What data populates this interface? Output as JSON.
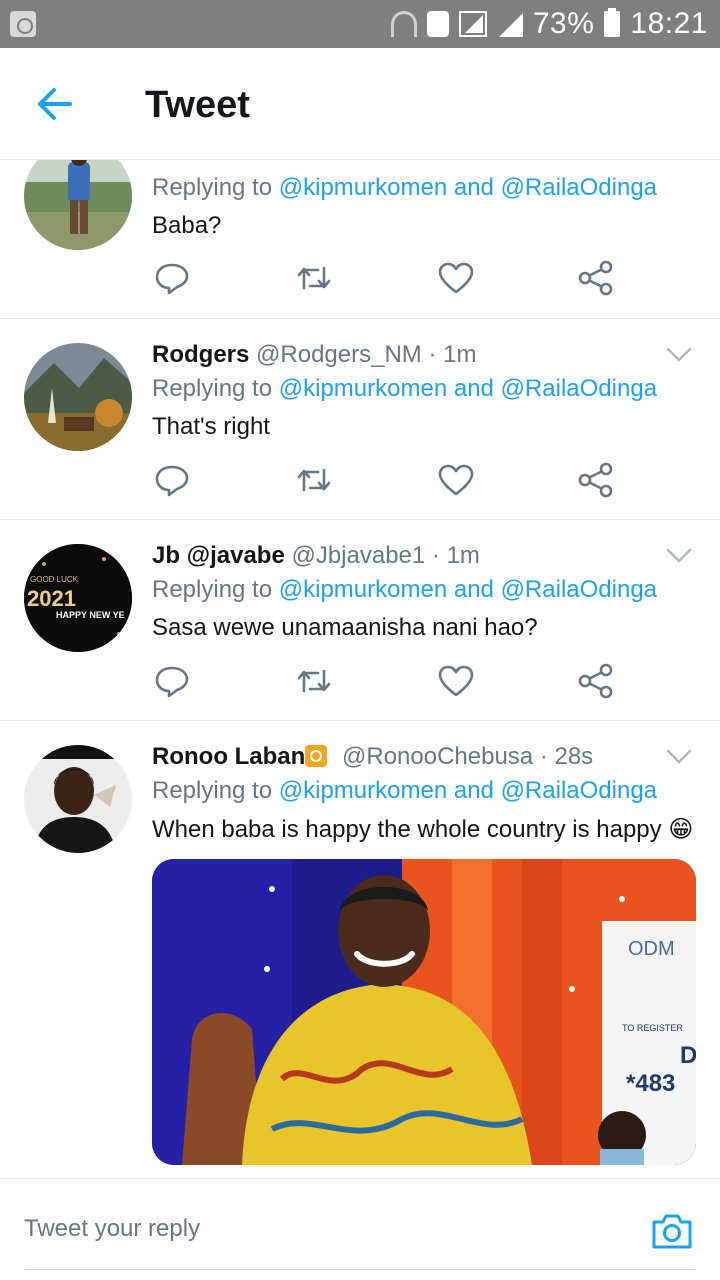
{
  "status_bar": {
    "battery_percent": "73%",
    "time": "18:21"
  },
  "header": {
    "title": "Tweet"
  },
  "replying_prefix": "Replying to",
  "mentions": {
    "first": "@kipmurkomen",
    "joiner": "and",
    "second": "@RailaOdinga"
  },
  "tweets": [
    {
      "name": "",
      "handle": "",
      "time": "",
      "text": "Baba?"
    },
    {
      "name": "Rodgers",
      "handle": "@Rodgers_NM",
      "time": "· 1m",
      "text": "That's right"
    },
    {
      "name": "Jb @javabe",
      "handle": "@Jbjavabe1",
      "time": "· 1m",
      "text": "Sasa wewe unamaanisha nani hao?",
      "avatar_text": {
        "year": "2021",
        "good_luck": "GOOD LUCK",
        "happy_new": "HAPPY NEW YE"
      }
    },
    {
      "name": "Ronoo Laban",
      "handle": "@RonooChebusa",
      "time": "· 28s",
      "text": "When baba is happy the whole country is happy 😁",
      "media_sign": {
        "line1": "ODM",
        "line2": "TO REGISTER",
        "line3": "D",
        "line4": "*483"
      }
    }
  ],
  "reply_bar": {
    "placeholder": "Tweet your reply"
  },
  "colors": {
    "accent": "#1da1f2",
    "secondary_text": "#657786",
    "divider": "#e1e8ed",
    "status_bar": "#7f7f7f"
  },
  "icons": [
    "back-arrow-icon",
    "reply-icon",
    "retweet-icon",
    "like-icon",
    "share-icon",
    "chevron-down-icon",
    "camera-icon"
  ]
}
